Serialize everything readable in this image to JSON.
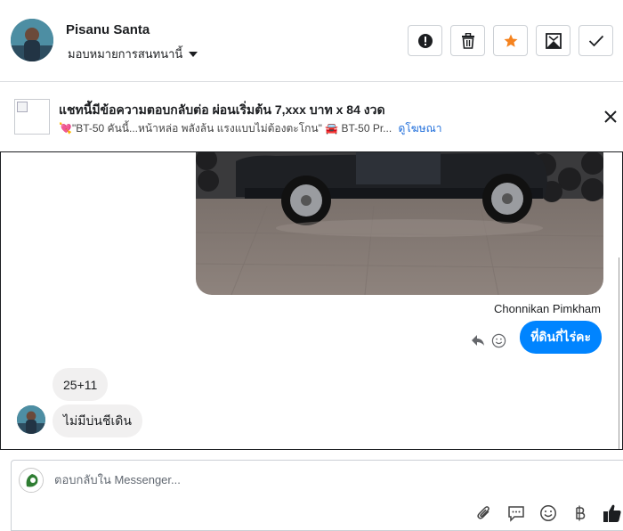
{
  "header": {
    "contact_name": "Pisanu Santa",
    "assign_label": "มอบหมายการสนทนานี้",
    "actions": {
      "spam": "alert-icon",
      "delete": "trash-icon",
      "star": "star-icon",
      "mark_unread": "mark-unread-icon",
      "done": "check-icon"
    }
  },
  "ad": {
    "title": "แชทนี้มีข้อความตอบกลับต่อ ผ่อนเริ่มต้น 7,xxx บาท x 84 งวด",
    "subtitle": "💘\"BT-50 คันนี้...หน้าหล่อ พลังล้น แรงแบบไม่ต้องตะโกน\" 🚘 BT-50 Pr...",
    "link": "ดูโฆษณา"
  },
  "messages": {
    "sender_name": "Chonnikan Pimkham",
    "outgoing": "ที่ดินกี่ไร่คะ",
    "incoming": [
      "25+11",
      "ไม่มีบ่นชีเดิน"
    ]
  },
  "composer": {
    "placeholder": "ตอบกลับใน Messenger..."
  },
  "colors": {
    "accent": "#0084ff",
    "star": "#f5831f",
    "link": "#216fdb"
  }
}
